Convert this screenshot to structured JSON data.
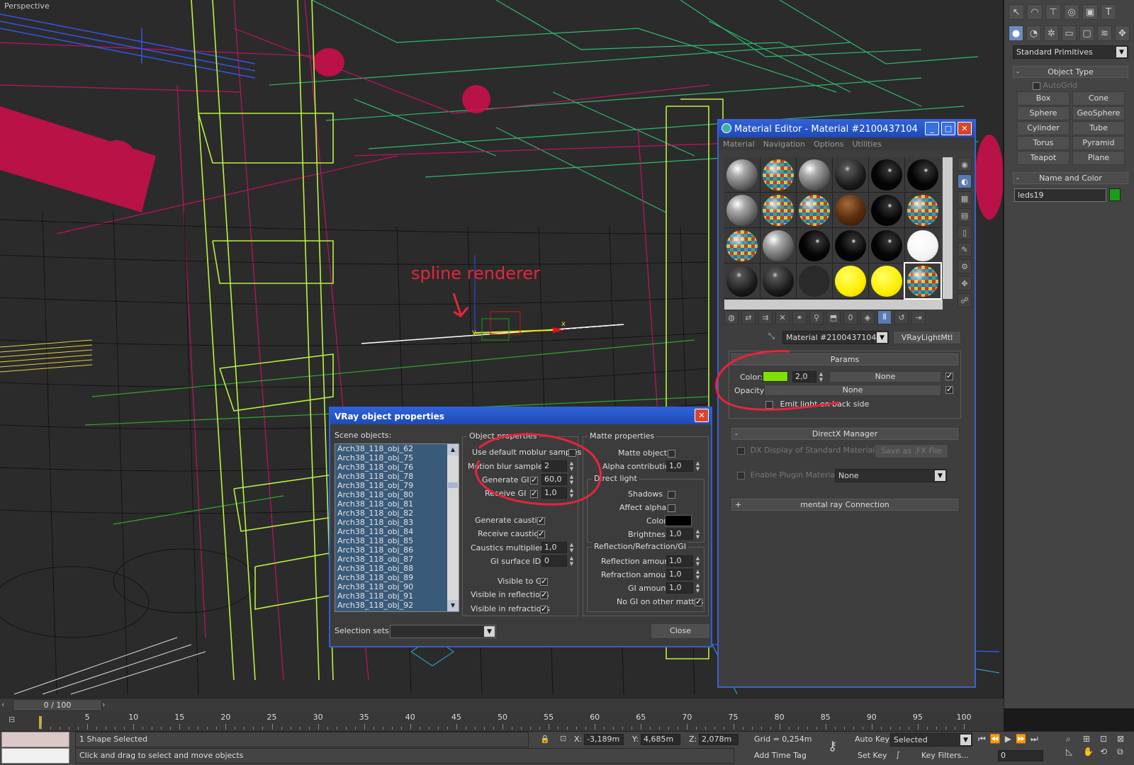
{
  "viewport": {
    "label": "Perspective",
    "annotation": "spline renderer",
    "axis_labels": [
      "y",
      "x"
    ]
  },
  "command_panel": {
    "category": "Standard Primitives",
    "object_type": {
      "header": "Object Type",
      "autogrid": "AutoGrid",
      "buttons": [
        "Box",
        "Cone",
        "Sphere",
        "GeoSphere",
        "Cylinder",
        "Tube",
        "Torus",
        "Pyramid",
        "Teapot",
        "Plane"
      ]
    },
    "name_and_color": {
      "header": "Name and Color",
      "name_value": "leds19",
      "color": "#1a9e1a"
    }
  },
  "material_editor": {
    "title": "Material Editor - Material #2100437104",
    "menu": [
      "Material",
      "Navigation",
      "Options",
      "Utilities"
    ],
    "material_name": "Material #2100437104",
    "material_type": "VRayLightMtl",
    "params": {
      "header": "Params",
      "color_label": "Color:",
      "color_swatch": "#7fe000",
      "color_value": "2,0",
      "color_map": "None",
      "opacity_label": "Opacity:",
      "opacity_map": "None",
      "emit_back": "Emit light on back side"
    },
    "directx": {
      "header": "DirectX Manager",
      "dx_display": "DX Display of Standard Material",
      "save_fx": "Save as .FX File",
      "enable_plugin": "Enable Plugin Material",
      "plugin_value": "None"
    },
    "mental_ray": "mental ray Connection",
    "slots": [
      "grey",
      "check",
      "grey",
      "dark",
      "black",
      "black",
      "grey",
      "check",
      "check",
      "wood",
      "black",
      "check",
      "check",
      "grey",
      "black",
      "black",
      "black",
      "white",
      "dark",
      "dark",
      "void",
      "yellow",
      "yellow",
      "check"
    ]
  },
  "vray_dialog": {
    "title": "VRay object properties",
    "scene_objects_label": "Scene objects:",
    "objects": [
      "Arch38_118_obj_62",
      "Arch38_118_obj_75",
      "Arch38_118_obj_76",
      "Arch38_118_obj_78",
      "Arch38_118_obj_79",
      "Arch38_118_obj_80",
      "Arch38_118_obj_81",
      "Arch38_118_obj_82",
      "Arch38_118_obj_83",
      "Arch38_118_obj_84",
      "Arch38_118_obj_85",
      "Arch38_118_obj_86",
      "Arch38_118_obj_87",
      "Arch38_118_obj_88",
      "Arch38_118_obj_89",
      "Arch38_118_obj_90",
      "Arch38_118_obj_91",
      "Arch38_118_obj_92"
    ],
    "object_properties": {
      "title": "Object properties",
      "use_default_moblur": "Use default moblur samples",
      "motion_blur_samples": "Motion blur samples",
      "motion_blur_value": "2",
      "generate_gi": "Generate GI",
      "generate_gi_value": "60,0",
      "receive_gi": "Receive GI",
      "receive_gi_value": "1,0",
      "generate_caustics": "Generate caustics",
      "receive_caustics": "Receive caustics",
      "caustics_multiplier": "Caustics multiplier",
      "caustics_multiplier_value": "1,0",
      "gi_surface_id": "GI surface ID",
      "gi_surface_id_value": "0",
      "visible_to_gi": "Visible to GI",
      "visible_in_reflections": "Visible in reflections",
      "visible_in_refractions": "Visible in refractions"
    },
    "matte_properties": {
      "title": "Matte properties",
      "matte_object": "Matte object",
      "alpha_contribution": "Alpha contribution",
      "alpha_contribution_value": "1,0",
      "direct_light": "Direct light",
      "shadows": "Shadows",
      "affect_alpha": "Affect alpha",
      "color": "Color",
      "brightness": "Brightness",
      "brightness_value": "1,0",
      "refl_group": "Reflection/Refraction/GI",
      "reflection_amount": "Reflection amount",
      "reflection_amount_value": "1,0",
      "refraction_amount": "Refraction amount",
      "refraction_amount_value": "1,0",
      "gi_amount": "GI amount",
      "gi_amount_value": "1,0",
      "no_gi_on_mattes": "No GI on other mattes"
    },
    "selection_sets_label": "Selection sets:",
    "close": "Close"
  },
  "timeline": {
    "frame": "0 / 100",
    "ticks": [
      "5",
      "10",
      "15",
      "20",
      "25",
      "30",
      "35",
      "40",
      "45",
      "50",
      "55",
      "60",
      "65",
      "70",
      "75",
      "80",
      "85",
      "90",
      "95",
      "100"
    ]
  },
  "status": {
    "selection": "1 Shape Selected",
    "prompt": "Click and drag to select and move objects",
    "x_label": "X:",
    "x_value": "-3,189m",
    "y_label": "Y:",
    "y_value": "4,685m",
    "z_label": "Z:",
    "z_value": "2,078m",
    "grid": "Grid = 0,254m",
    "add_time_tag": "Add Time Tag",
    "auto_key": "Auto Key",
    "set_key": "Set Key",
    "selected": "Selected",
    "key_filters": "Key Filters...",
    "frame_value": "0"
  }
}
